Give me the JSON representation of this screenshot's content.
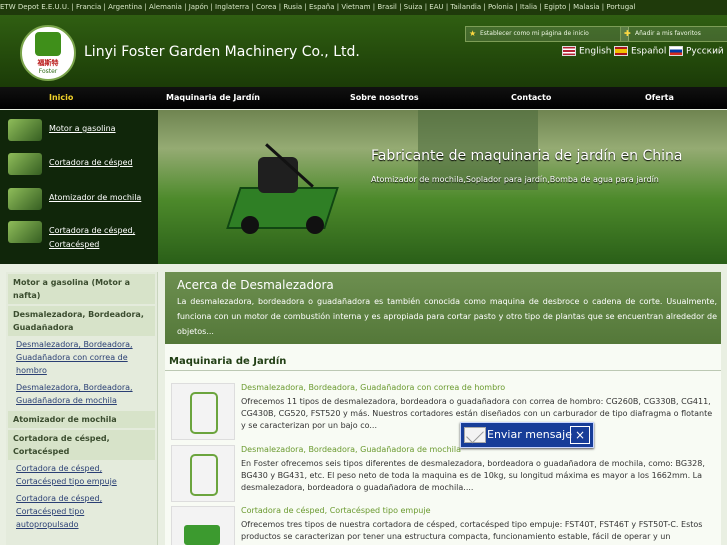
{
  "top_links": [
    "ETW Depot E.E.U.U.",
    "Francia",
    "Argentina",
    "Alemania",
    "Japón",
    "Inglaterra",
    "Corea",
    "Rusia",
    "España",
    "Vietnam",
    "Brasil",
    "Suiza",
    "EAU",
    "Tailandia",
    "Polonia",
    "Italia",
    "Egipto",
    "Malasia",
    "Portugal"
  ],
  "header": {
    "company": "Linyi Foster Garden Machinery Co., Ltd.",
    "logo_cn": "福斯特",
    "logo_en": "Foster",
    "set_homepage": "Establecer como mi página de inicio",
    "add_favorites": "Añadir a mis favoritos",
    "languages": [
      "English",
      "Español",
      "Русский"
    ]
  },
  "nav": [
    "Inicio",
    "Maquinaria de Jardín",
    "Sobre nosotros",
    "Contacto",
    "Oferta"
  ],
  "quick_links": [
    "Motor a gasolina",
    "Cortadora de césped",
    "Atomizador de mochila",
    "Cortadora de césped, Cortacésped"
  ],
  "banner": {
    "title": "Fabricante de maquinaria de jardín en China",
    "subtitle": "Atomizador de mochila,Soplador para jardín,Bomba de agua para jardín"
  },
  "sidebar_categories": [
    {
      "title": "Motor a gasolina (Motor a nafta)",
      "items": []
    },
    {
      "title": "Desmalezadora, Bordeadora, Guadañadora",
      "items": [
        "Desmalezadora, Bordeadora, Guadañadora con correa de hombro",
        "Desmalezadora, Bordeadora, Guadañadora de mochila"
      ]
    },
    {
      "title": "Atomizador de mochila",
      "items": []
    },
    {
      "title": "Cortadora de césped, Cortacésped",
      "items": [
        "Cortadora de césped, Cortacésped tipo empuje",
        "Cortadora de césped, Cortacésped tipo autopropulsado"
      ]
    }
  ],
  "about": {
    "title": "Acerca de Desmalezadora",
    "text": "La desmalezadora, bordeadora o guadañadora es también conocida como maquina de desbroce o cadena de corte. Usualmente, funciona con un motor de combustión interna y es apropiada para cortar pasto y otro tipo de plantas que se encuentran alrededor de objetos..."
  },
  "section_title": "Maquinaria de Jardín",
  "products": [
    {
      "name": "Desmalezadora, Bordeadora, Guadañadora con correa de hombro",
      "desc": "Ofrecemos 11 tipos de desmalezadora, bordeadora o guadañadora con correa de hombro: CG260B, CG330B, CG411, CG430B, CG520, FST520 y más. Nuestros cortadores están diseñados con un carburador de tipo diafragma o flotante y se caracterizan por un bajo co..."
    },
    {
      "name": "Desmalezadora, Bordeadora, Guadañadora de mochila",
      "desc": "En Foster ofrecemos seis tipos diferentes de desmalezadora, bordeadora o guadañadora de mochila, como: BG328, BG430 y BG431, etc. El peso neto de toda la maquina es de 10kg, su longitud máxima es mayor a los 1662mm. La desmalezadora, bordeadora o guadañadora de mochila...."
    },
    {
      "name": "Cortadora de césped, Cortacésped tipo empuje",
      "desc": "Ofrecemos tres tipos de nuestra cortadora de césped, cortacésped tipo empuje: FST40T, FST46T y FST50T-C. Estos productos se caracterizan por tener una estructura compacta, funcionamiento estable, fácil de operar y un"
    }
  ],
  "message_box": {
    "label": "Enviar mensaje"
  }
}
